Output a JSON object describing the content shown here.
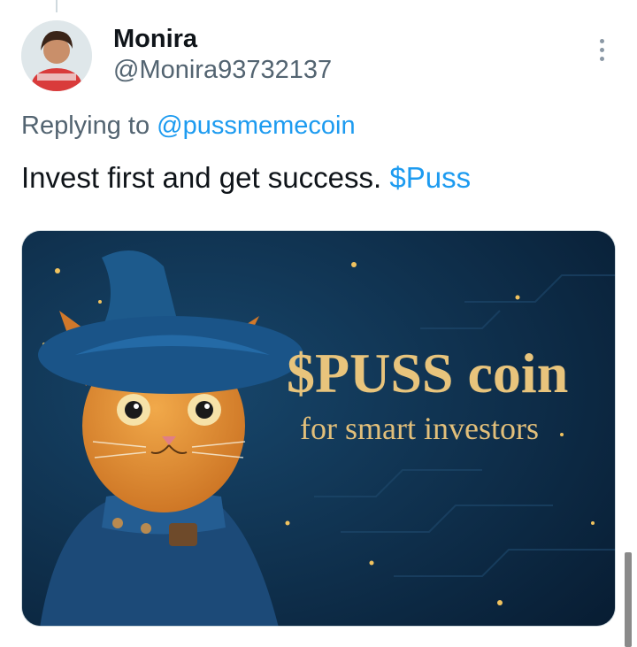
{
  "tweet": {
    "author": {
      "display_name": "Monira",
      "handle": "@Monira93732137",
      "avatar_icon": "user-avatar"
    },
    "more_icon": "more-vertical-icon",
    "reply_to": {
      "prefix": "Replying to ",
      "handle": "@pussmemecoin"
    },
    "text": {
      "body": "Invest first and get success. ",
      "cashtag": "$Puss"
    },
    "media": {
      "title": "$PUSS coin",
      "subtitle": "for smart investors"
    }
  },
  "colors": {
    "link": "#1d9bf0",
    "secondary_text": "#536471",
    "media_background": "#0c2a45",
    "media_title": "#e8c47c"
  }
}
